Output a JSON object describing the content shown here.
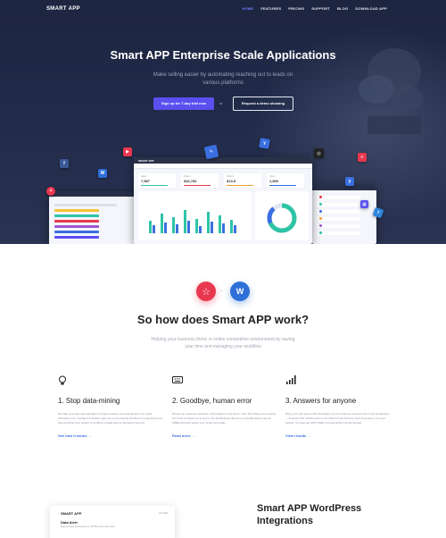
{
  "nav": {
    "logo": "SMART APP",
    "items": [
      "HOME",
      "FEATURES",
      "PRICING",
      "SUPPORT",
      "BLOG",
      "DOWNLOAD APP"
    ]
  },
  "hero": {
    "title": "Smart APP Enterprise Scale Applications",
    "subtitle": "Make selling easier by automating reaching out to leads on various platforms",
    "primary_button": "Sign up for 7-day trial now",
    "or_label": "or",
    "secondary_button": "Request a demo showing"
  },
  "dashboard": {
    "logo": "SMART APP",
    "stats": [
      {
        "label": "Sales",
        "value": "7,587",
        "color": "#2ec4a6"
      },
      {
        "label": "Orders",
        "value": "$46,782",
        "color": "#e8384f"
      },
      {
        "label": "Visitors",
        "value": "$13.8",
        "color": "#f0a030"
      },
      {
        "label": "Users",
        "value": "1,890",
        "color": "#3b6fe0"
      }
    ]
  },
  "how": {
    "title": "So how does Smart APP work?",
    "subtitle": "Helping your business thrive in online competitive environment by saving your time and managing your workflow",
    "steps": [
      {
        "icon": "lightbulb-icon",
        "title": "1. Stop data-mining",
        "text": "We take your data automatically to surface answers and attachments you might otherwise miss. Configure business apps via a user-friendly interface for everything from plug and drop form design to workflow configuration to advanced security.",
        "link": "See how it works"
      },
      {
        "icon": "keyboard-icon",
        "title": "2. Goodbye, human error",
        "text": "Browse an extensive selection of SmartApps in the Store. Can't find what you're looking for? Post a request for an app in the AppNetwork. Become an AppMerchant user for FREE and start selling your Smart App today.",
        "link": "Read more"
      },
      {
        "icon": "signal-icon",
        "title": "3. Answers for anyone",
        "text": "Bring your own device with SmartApp.com for real-time access to all of your SmartApps — Android, iOS, Window and more! Click the link below to learn how easy it is to get started. You also get SOR FREE of personal life Central storage.",
        "link": "View results"
      }
    ]
  },
  "bottom": {
    "card_logo": "SMART APP",
    "card_close": "CLOSE",
    "card_title": "Data Alert",
    "card_text": "Signup has increased to 4,578 in the last hour",
    "section_title": "Smart APP WordPress Integrations"
  },
  "colors": {
    "accent": "#5a4ff0",
    "link": "#3b6fe0",
    "hero_bg": "#1d2540"
  }
}
